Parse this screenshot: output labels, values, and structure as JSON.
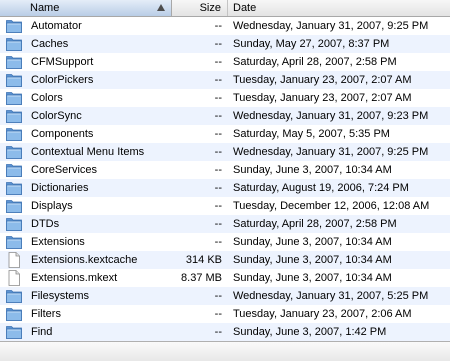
{
  "header": {
    "name_label": "Name",
    "size_label": "Size",
    "date_label": "Date"
  },
  "rows": [
    {
      "name": "Automator",
      "size": "--",
      "date": "Wednesday, January 31, 2007, 9:25 PM",
      "icon": "folder-icon"
    },
    {
      "name": "Caches",
      "size": "--",
      "date": "Sunday, May 27, 2007, 8:37 PM",
      "icon": "folder-icon"
    },
    {
      "name": "CFMSupport",
      "size": "--",
      "date": "Saturday, April 28, 2007, 2:58 PM",
      "icon": "folder-icon"
    },
    {
      "name": "ColorPickers",
      "size": "--",
      "date": "Tuesday, January 23, 2007, 2:07 AM",
      "icon": "folder-icon"
    },
    {
      "name": "Colors",
      "size": "--",
      "date": "Tuesday, January 23, 2007, 2:07 AM",
      "icon": "folder-icon"
    },
    {
      "name": "ColorSync",
      "size": "--",
      "date": "Wednesday, January 31, 2007, 9:23 PM",
      "icon": "folder-icon"
    },
    {
      "name": "Components",
      "size": "--",
      "date": "Saturday, May 5, 2007, 5:35 PM",
      "icon": "folder-icon"
    },
    {
      "name": "Contextual Menu Items",
      "size": "--",
      "date": "Wednesday, January 31, 2007, 9:25 PM",
      "icon": "folder-icon"
    },
    {
      "name": "CoreServices",
      "size": "--",
      "date": "Sunday, June 3, 2007, 10:34 AM",
      "icon": "folder-icon"
    },
    {
      "name": "Dictionaries",
      "size": "--",
      "date": "Saturday, August 19, 2006, 7:24 PM",
      "icon": "folder-icon"
    },
    {
      "name": "Displays",
      "size": "--",
      "date": "Tuesday, December 12, 2006, 12:08 AM",
      "icon": "folder-icon"
    },
    {
      "name": "DTDs",
      "size": "--",
      "date": "Saturday, April 28, 2007, 2:58 PM",
      "icon": "folder-icon"
    },
    {
      "name": "Extensions",
      "size": "--",
      "date": "Sunday, June 3, 2007, 10:34 AM",
      "icon": "folder-icon"
    },
    {
      "name": "Extensions.kextcache",
      "size": "314 KB",
      "date": "Sunday, June 3, 2007, 10:34 AM",
      "icon": "document-icon"
    },
    {
      "name": "Extensions.mkext",
      "size": "8.37 MB",
      "date": "Sunday, June 3, 2007, 10:34 AM",
      "icon": "document-icon"
    },
    {
      "name": "Filesystems",
      "size": "--",
      "date": "Wednesday, January 31, 2007, 5:25 PM",
      "icon": "folder-icon"
    },
    {
      "name": "Filters",
      "size": "--",
      "date": "Tuesday, January 23, 2007, 2:06 AM",
      "icon": "folder-icon"
    },
    {
      "name": "Find",
      "size": "--",
      "date": "Sunday, June 3, 2007, 1:42 PM",
      "icon": "folder-icon"
    }
  ],
  "colors": {
    "row_stripe": "#edf3fe",
    "folder_blue": "#6fa3dc",
    "header_selected": "#c9d9ee"
  }
}
